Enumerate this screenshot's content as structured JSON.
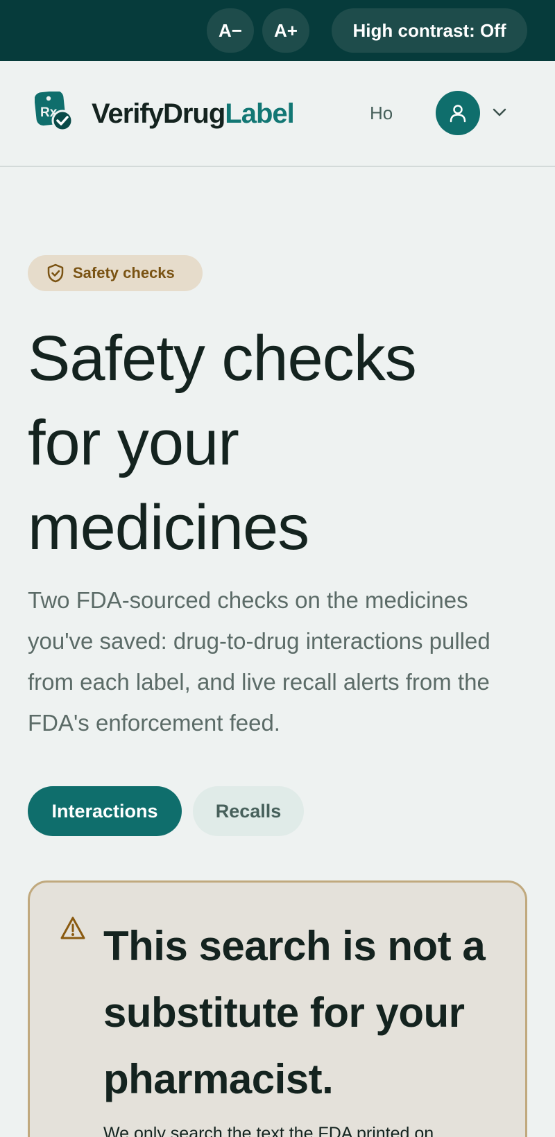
{
  "toolbar": {
    "decrease_text_label": "A−",
    "increase_text_label": "A+",
    "contrast_label": "High contrast: Off"
  },
  "header": {
    "logo_icon": "rx-check-icon",
    "logo_icon_text": "Rx",
    "brand_part1": "VerifyDrug",
    "brand_part2": "Label",
    "nav_peek": "Ho",
    "avatar_icon": "user-icon",
    "menu_icon": "chevron-down-icon"
  },
  "badge": {
    "icon": "shield-check-icon",
    "label": "Safety checks"
  },
  "hero": {
    "title_line1": "Safety checks",
    "title_line2": "for your",
    "title_line3": "medicines",
    "description": "Two FDA-sourced checks on the medicines you've saved: drug-to-drug interactions pulled from each label, and live recall alerts from the FDA's enforcement feed."
  },
  "tabs": [
    {
      "label": "Interactions",
      "active": true
    },
    {
      "label": "Recalls",
      "active": false
    }
  ],
  "notice": {
    "icon": "warning-triangle-icon",
    "title_line1": "This search is not a",
    "title_line2": "substitute for your",
    "title_line3": "pharmacist.",
    "body": "We only search the text the FDA printed on"
  },
  "colors": {
    "topbar": "#063b3b",
    "accent": "#0f6e6c",
    "brand_accent": "#127774",
    "badge_bg": "#e6dccb",
    "badge_text": "#7a5313",
    "notice_border": "#c0a97e",
    "page_bg": "#eef2f1"
  }
}
